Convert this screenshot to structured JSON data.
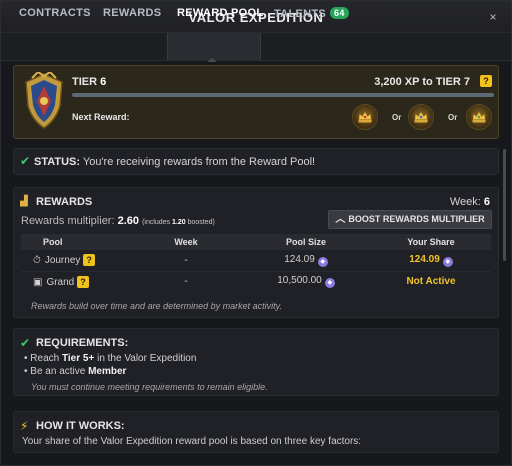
{
  "window": {
    "title": "VALOR EXPEDITION",
    "close": "×"
  },
  "tabs": [
    {
      "label": "CONTRACTS"
    },
    {
      "label": "REWARDS"
    },
    {
      "label": "REWARD POOL"
    },
    {
      "label": "TALENTS",
      "badge": "64"
    }
  ],
  "tier": {
    "label": "TIER",
    "value": "6",
    "xp_text": "3,200 XP to TIER 7",
    "help": "?",
    "progress": 1.0,
    "next_reward_label": "Next Reward:",
    "or_label": "Or"
  },
  "status": {
    "label": "STATUS:",
    "text": "You're receiving rewards from the Reward Pool!"
  },
  "rewards": {
    "title": "REWARDS",
    "week_label": "Week:",
    "week_value": "6",
    "multiplier_label": "Rewards multiplier:",
    "multiplier_value": "2.60",
    "multiplier_detail_pre": "(includes",
    "multiplier_boost": "1.20",
    "multiplier_detail_post": "boosted)",
    "boost_button": "BOOST REWARDS MULTIPLIER",
    "columns": [
      "Pool",
      "Week",
      "Pool Size",
      "Your Share"
    ],
    "rows": [
      {
        "pool": "Journey",
        "week": "-",
        "size": "124.09",
        "share": "124.09"
      },
      {
        "pool": "Grand",
        "week": "-",
        "size": "10,500.00",
        "share": "Not Active"
      }
    ],
    "footnote": "Rewards build over time and are determined by market activity."
  },
  "requirements": {
    "title": "REQUIREMENTS:",
    "line1_pre": "• Reach ",
    "line1_bold": "Tier 5+",
    "line1_post": " in the Valor Expedition",
    "line2_pre": "• Be an active ",
    "line2_bold": "Member",
    "note": "You must continue meeting requirements to remain eligible."
  },
  "how": {
    "title": "HOW IT WORKS:",
    "text": "Your share of the Valor Expedition reward pool is based on three key factors:"
  },
  "colors": {
    "accent_gold": "#f0c42a",
    "status_green": "#3fc86a",
    "tab_badge": "#27a55a",
    "token_purple": "#8a7be0"
  },
  "icons": [
    "shield-emblem-icon",
    "crown-reward-icon",
    "check-icon",
    "coins-icon",
    "stopwatch-icon",
    "gift-icon",
    "token-icon",
    "lightning-icon",
    "help-icon",
    "chevron-up-icon",
    "close-icon"
  ]
}
